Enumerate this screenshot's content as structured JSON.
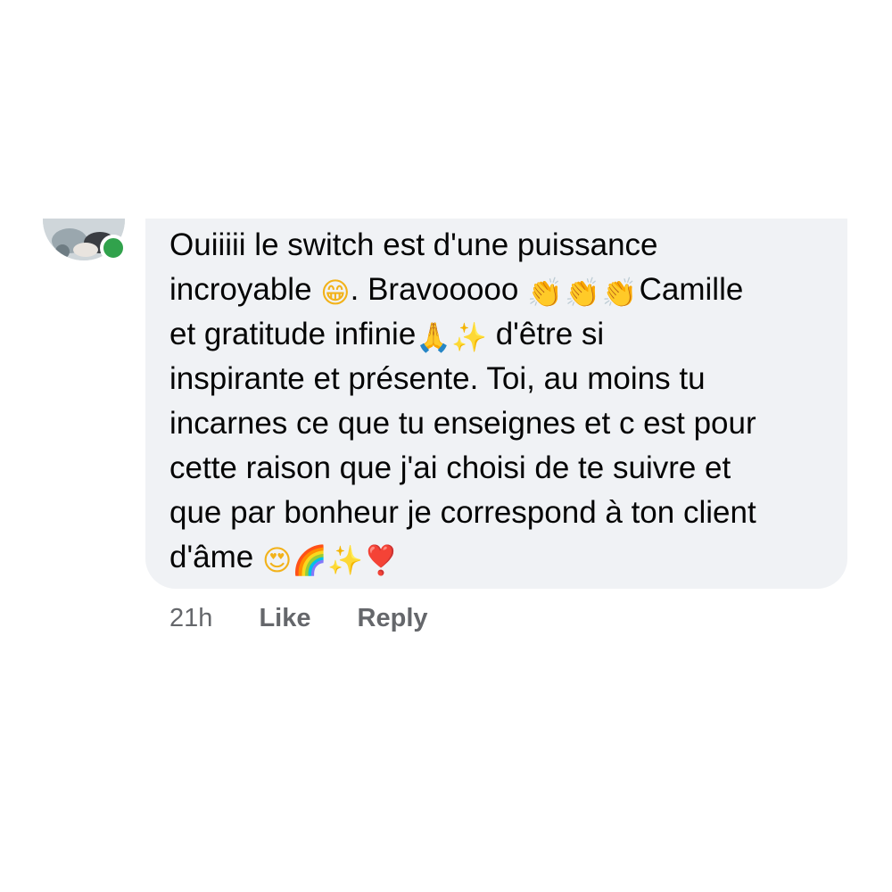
{
  "comment": {
    "online": true,
    "lines": [
      [
        "Ouiiiii le switch est d'une puissance"
      ],
      [
        "incroyable ",
        "😁",
        ". Bravooooo ",
        "👏👏👏",
        "Camille"
      ],
      [
        "et gratitude infinie",
        "🙏",
        " ✨",
        " d'être si"
      ],
      [
        "inspirante et présente. Toi, au moins tu"
      ],
      [
        "incarnes ce que tu enseignes et c est pour"
      ],
      [
        "cette raison que j'ai choisi de te suivre et"
      ],
      [
        "que par bonheur je correspond à ton client"
      ],
      [
        "d'âme ",
        "😍",
        "🌈",
        "✨",
        " ❣️"
      ]
    ]
  },
  "meta": {
    "time": "21h",
    "like_label": "Like",
    "reply_label": "Reply"
  },
  "icons": {
    "avatar": "profile-photo",
    "online_status": "green-dot"
  },
  "colors": {
    "bubble": "#f0f2f5",
    "text": "#050505",
    "meta": "#65676b",
    "online": "#31a24c"
  }
}
